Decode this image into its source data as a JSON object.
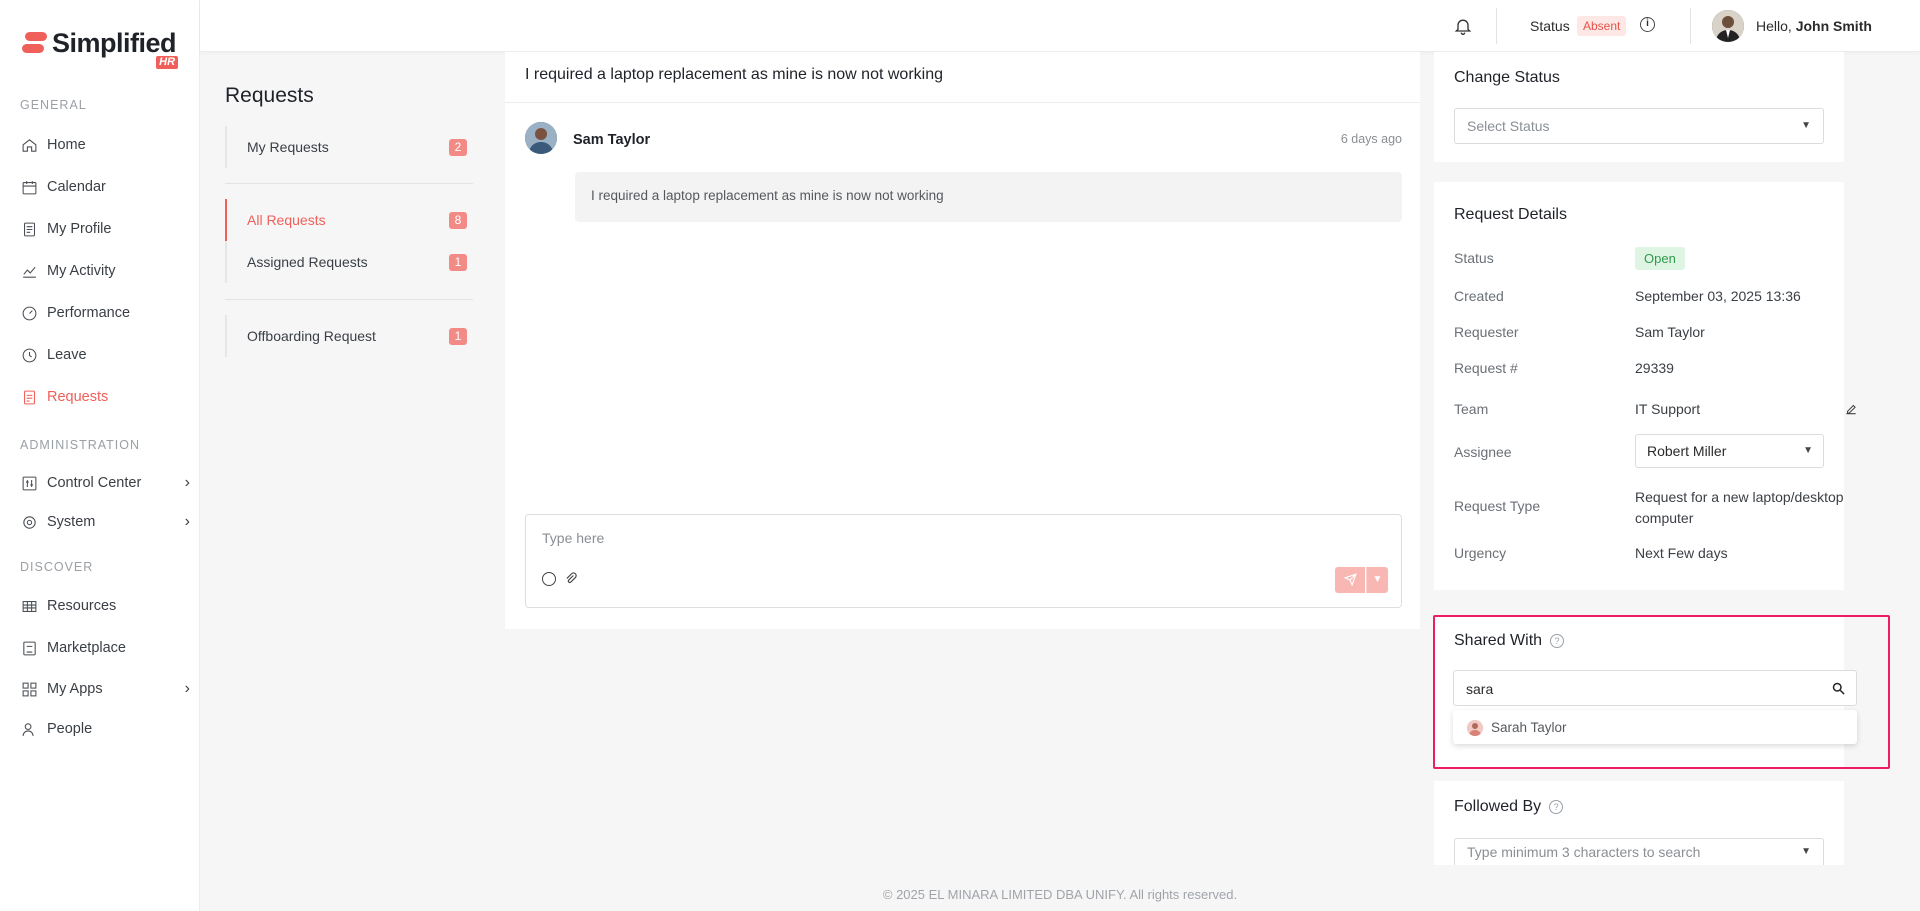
{
  "brand": {
    "name": "Simplified",
    "sub": "HR",
    "accent": "#f0605a"
  },
  "sidebar": {
    "sections": [
      {
        "label": "GENERAL"
      },
      {
        "label": "ADMINISTRATION"
      },
      {
        "label": "DISCOVER"
      }
    ],
    "items": [
      {
        "label": "Home",
        "icon": "home-icon"
      },
      {
        "label": "Calendar",
        "icon": "calendar-icon"
      },
      {
        "label": "My Profile",
        "icon": "profile-icon"
      },
      {
        "label": "My Activity",
        "icon": "activity-icon"
      },
      {
        "label": "Performance",
        "icon": "gauge-icon"
      },
      {
        "label": "Leave",
        "icon": "clock-icon"
      },
      {
        "label": "Requests",
        "icon": "requests-icon",
        "active": true
      },
      {
        "label": "Control Center",
        "icon": "sliders-icon"
      },
      {
        "label": "System",
        "icon": "gear-icon"
      },
      {
        "label": "Resources",
        "icon": "table-icon"
      },
      {
        "label": "Marketplace",
        "icon": "store-icon"
      },
      {
        "label": "My Apps",
        "icon": "grid-icon"
      },
      {
        "label": "People",
        "icon": "people-icon"
      }
    ]
  },
  "topbar": {
    "status_label": "Status",
    "status_value": "Absent",
    "greeting": "Hello,",
    "user_name": "John Smith"
  },
  "requests_nav": {
    "title": "Requests",
    "items": [
      {
        "label": "My Requests",
        "count": "2"
      },
      {
        "label": "All Requests",
        "count": "8",
        "active": true
      },
      {
        "label": "Assigned Requests",
        "count": "1"
      },
      {
        "label": "Offboarding Request",
        "count": "1"
      }
    ]
  },
  "conversation": {
    "title": "I required a laptop replacement as mine is now not working",
    "author": "Sam Taylor",
    "time": "6 days ago",
    "message": "I required a laptop replacement as mine is now not working",
    "composer_placeholder": "Type here"
  },
  "change_status": {
    "title": "Change Status",
    "placeholder": "Select Status"
  },
  "request_details": {
    "title": "Request Details",
    "status_label": "Status",
    "status_value": "Open",
    "created_label": "Created",
    "created_value": "September 03, 2025 13:36",
    "requester_label": "Requester",
    "requester_value": "Sam Taylor",
    "number_label": "Request #",
    "number_value": "29339",
    "team_label": "Team",
    "team_value": "IT Support",
    "assignee_label": "Assignee",
    "assignee_value": "Robert Miller",
    "type_label": "Request Type",
    "type_value": "Request for a new laptop/desktop computer",
    "urgency_label": "Urgency",
    "urgency_value": "Next Few days"
  },
  "shared_with": {
    "title": "Shared With",
    "search_value": "sara",
    "results": [
      {
        "name": "Sarah Taylor"
      }
    ]
  },
  "followed_by": {
    "title": "Followed By",
    "placeholder": "Type minimum 3 characters to search"
  },
  "footer": {
    "text": "© 2025 EL MINARA LIMITED DBA UNIFY. All rights reserved."
  }
}
